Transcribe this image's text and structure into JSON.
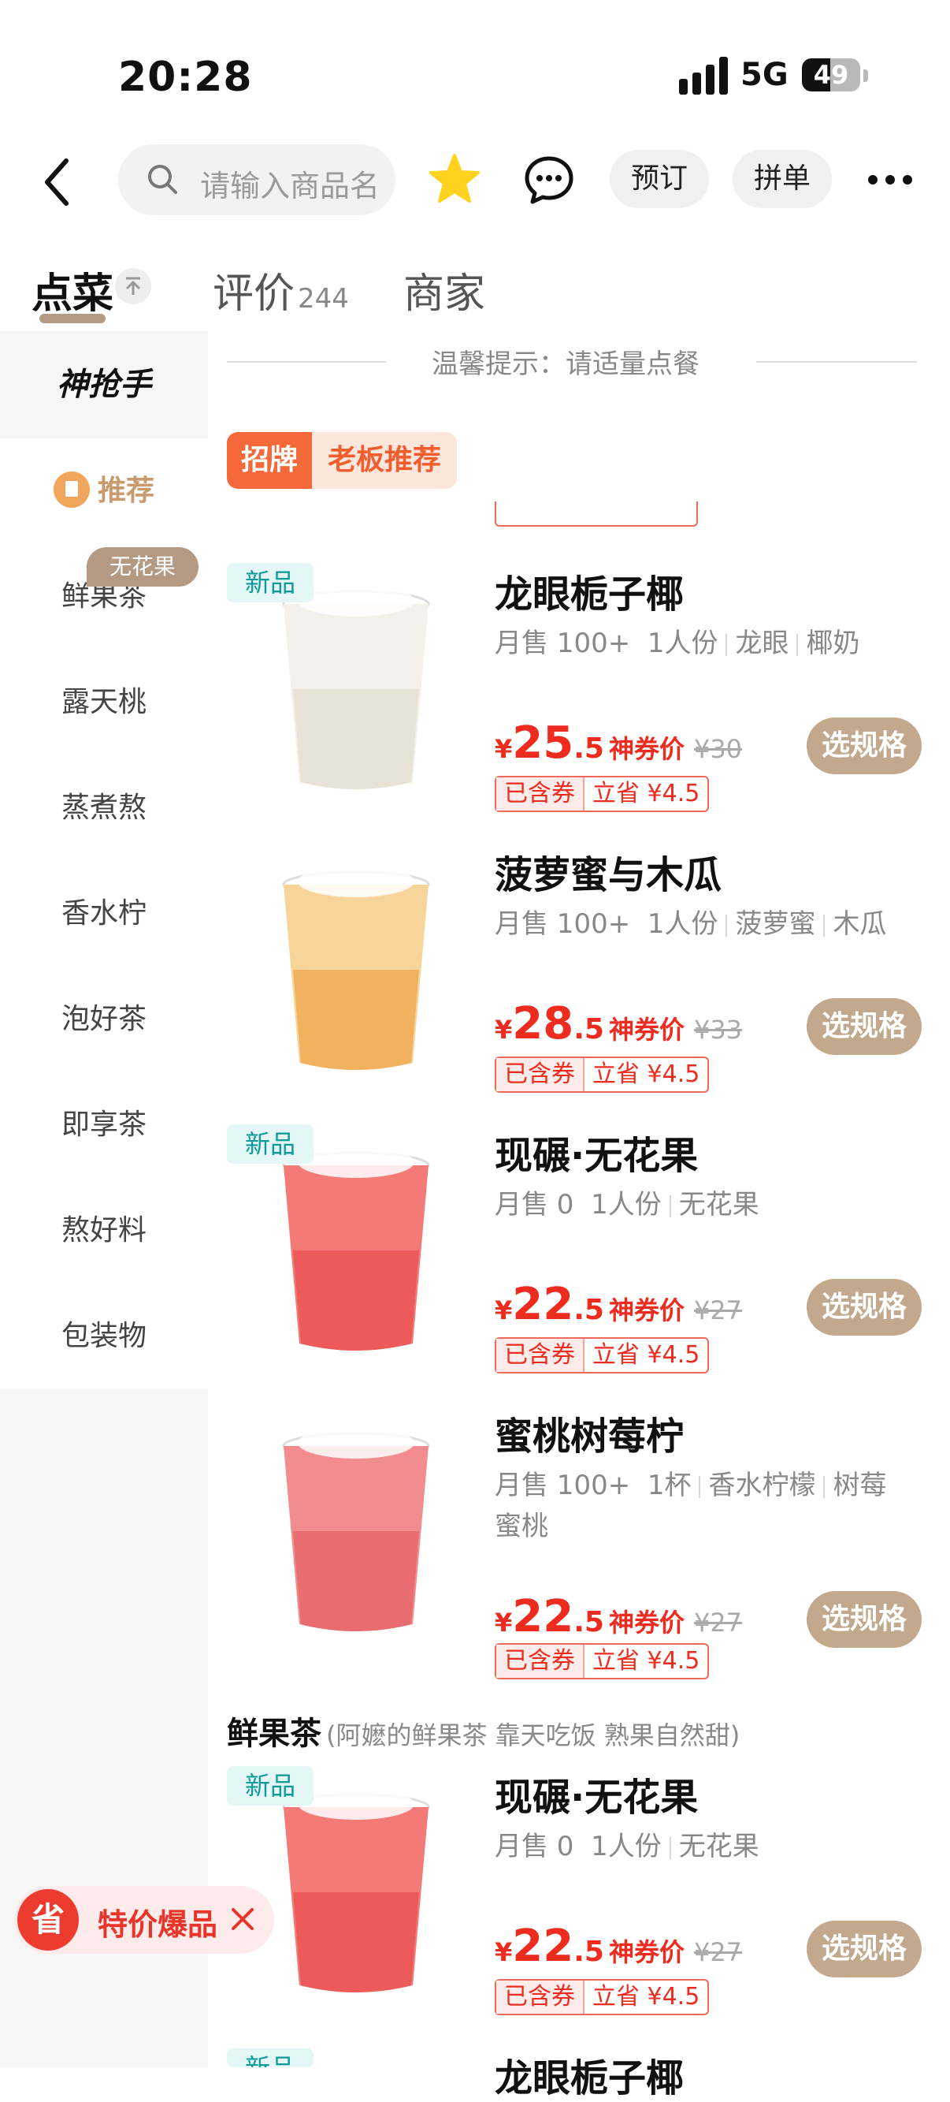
{
  "status_bar": {
    "time": "20:28",
    "network": "5G",
    "battery": "49",
    "battery_level": 0.49
  },
  "header": {
    "search_placeholder": "请输入商品名",
    "reserve_label": "预订",
    "group_label": "拼单"
  },
  "tabs": {
    "order": "点菜",
    "reviews": "评价",
    "reviews_count": "244",
    "merchant": "商家"
  },
  "sidebar": {
    "brand": "神抢手",
    "recommend": "推荐",
    "tag": "无花果",
    "items": [
      "鲜果茶",
      "露天桃",
      "蒸煮熬",
      "香水柠",
      "泡好茶",
      "即享茶",
      "熬好料",
      "包装物"
    ]
  },
  "notice": "温馨提示：请适量点餐",
  "signature": {
    "a": "招牌",
    "b": "老板推荐"
  },
  "labels": {
    "new": "新品",
    "currency": "¥",
    "coupon_price": "神券价",
    "coupon_included": "已含券",
    "select_spec": "选规格"
  },
  "products": [
    {
      "name": "龙眼栀子椰",
      "sales": "月售 100+",
      "portion": "1人份",
      "tags": [
        "龙眼",
        "椰奶"
      ],
      "meta2": "",
      "price_int": "25",
      "price_dec": ".5",
      "original": "¥30",
      "saved": "立省 ¥4.5",
      "is_new": true
    },
    {
      "name": "菠萝蜜与木瓜",
      "sales": "月售 100+",
      "portion": "1人份",
      "tags": [
        "菠萝蜜",
        "木瓜"
      ],
      "meta2": "",
      "price_int": "28",
      "price_dec": ".5",
      "original": "¥33",
      "saved": "立省 ¥4.5",
      "is_new": false
    },
    {
      "name": "现碾·无花果",
      "sales": "月售 0",
      "portion": "1人份",
      "tags": [
        "无花果"
      ],
      "meta2": "",
      "price_int": "22",
      "price_dec": ".5",
      "original": "¥27",
      "saved": "立省 ¥4.5",
      "is_new": true
    },
    {
      "name": "蜜桃树莓柠",
      "sales": "月售 100+",
      "portion": "1杯",
      "tags": [
        "香水柠檬",
        "树莓"
      ],
      "meta2": "蜜桃",
      "price_int": "22",
      "price_dec": ".5",
      "original": "¥27",
      "saved": "立省 ¥4.5",
      "is_new": false
    },
    {
      "name": "现碾·无花果",
      "sales": "月售 0",
      "portion": "1人份",
      "tags": [
        "无花果"
      ],
      "meta2": "",
      "price_int": "22",
      "price_dec": ".5",
      "original": "¥27",
      "saved": "立省 ¥4.5",
      "is_new": true
    }
  ],
  "section": {
    "title": "鲜果茶",
    "subtitle": "(阿嬷的鲜果茶 靠天吃饭 熟果自然甜)"
  },
  "promo": {
    "icon_text": "省",
    "text": "特价爆品"
  },
  "peek": {
    "new": "新品",
    "name": "龙眼栀子椰"
  }
}
